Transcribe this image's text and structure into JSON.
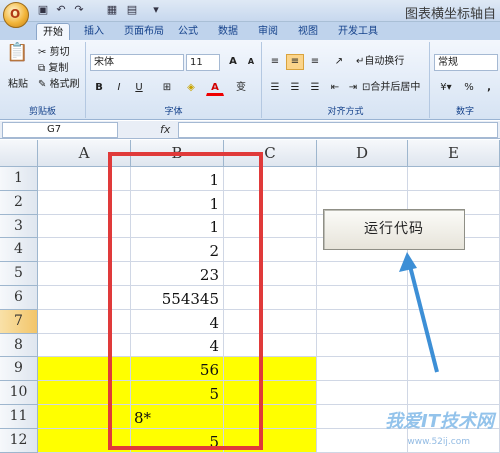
{
  "window": {
    "title": "图表横坐标轴自"
  },
  "office_button": {
    "glyph": "O"
  },
  "ribbon": {
    "tabs": [
      "开始",
      "插入",
      "页面布局",
      "公式",
      "数据",
      "审阅",
      "视图",
      "开发工具"
    ],
    "active_tab": "开始",
    "clipboard": {
      "paste": "粘贴",
      "cut": "剪切",
      "copy": "复制",
      "format_painter": "格式刷",
      "group": "剪贴板"
    },
    "font": {
      "name": "宋体",
      "size": "11",
      "grow": "A",
      "shrink": "A",
      "bold": "B",
      "italic": "I",
      "underline": "U",
      "color_a": "A",
      "phonetic": "变",
      "group": "字体"
    },
    "alignment": {
      "wrap": "自动换行",
      "merge": "合并后居中",
      "group": "对齐方式"
    },
    "number": {
      "format": "常规",
      "group": "数字",
      "percent": "%",
      "comma": ","
    }
  },
  "formula_bar": {
    "name_box": "G7",
    "fx": "fx",
    "value": ""
  },
  "grid": {
    "columns": [
      "A",
      "B",
      "C",
      "D",
      "E"
    ],
    "rows": [
      "1",
      "2",
      "3",
      "4",
      "5",
      "6",
      "7",
      "8",
      "9",
      "10",
      "11",
      "12"
    ],
    "selected_row": "7",
    "cells_b": [
      "1",
      "1",
      "1",
      "2",
      "23",
      "554345",
      "4",
      "4",
      "56",
      "5",
      "8*",
      "5"
    ],
    "b_left_aligned": [
      false,
      false,
      false,
      false,
      false,
      false,
      false,
      false,
      false,
      false,
      true,
      false
    ],
    "yellow_rows": [
      9,
      10,
      11,
      12
    ]
  },
  "run_button": {
    "label": "运行代码"
  },
  "watermark": {
    "text": "我爱IT技术网",
    "url": "www.52ij.com"
  }
}
